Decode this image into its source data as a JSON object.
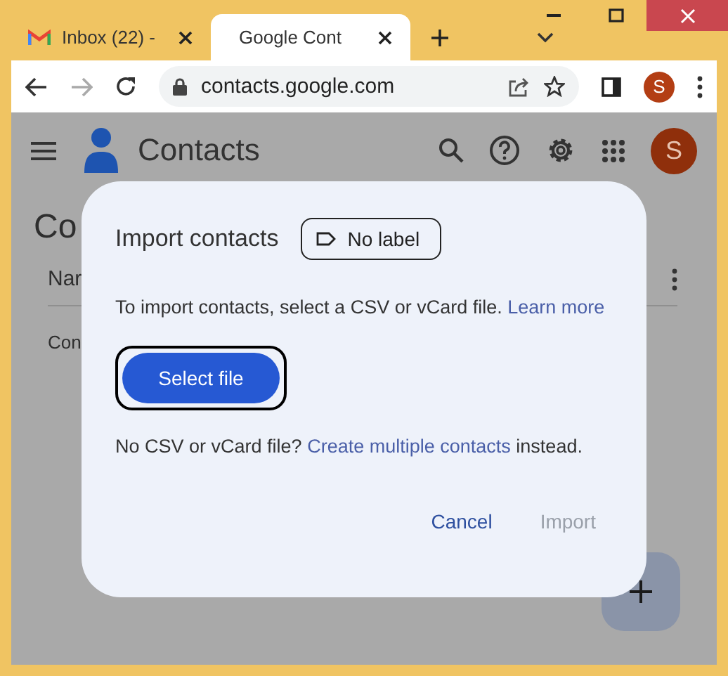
{
  "tabs": [
    {
      "kind": "mail",
      "title": "Inbox (22) -",
      "selected": false
    },
    {
      "kind": "contacts",
      "title": "Google Cont",
      "selected": true
    }
  ],
  "toolbar": {
    "address": "contacts.google.com",
    "profile": "S"
  },
  "app": {
    "title": "Contacts",
    "avatar": "S",
    "heading": "Co",
    "column_1": "Nar",
    "row_1": "Con"
  },
  "dialog": {
    "title": "Import contacts",
    "label_chip": "No label",
    "instructions": {
      "text": "To import contacts, select a CSV or vCard file.",
      "link": "Learn more"
    },
    "select_button": {
      "label": "Select file",
      "focused": true
    },
    "footer": {
      "before": "No CSV or vCard file?",
      "link": "Create multiple contacts",
      "after": "instead."
    },
    "actions": [
      {
        "label": "Cancel",
        "disabled": false
      },
      {
        "label": "Import",
        "disabled": true
      }
    ]
  }
}
